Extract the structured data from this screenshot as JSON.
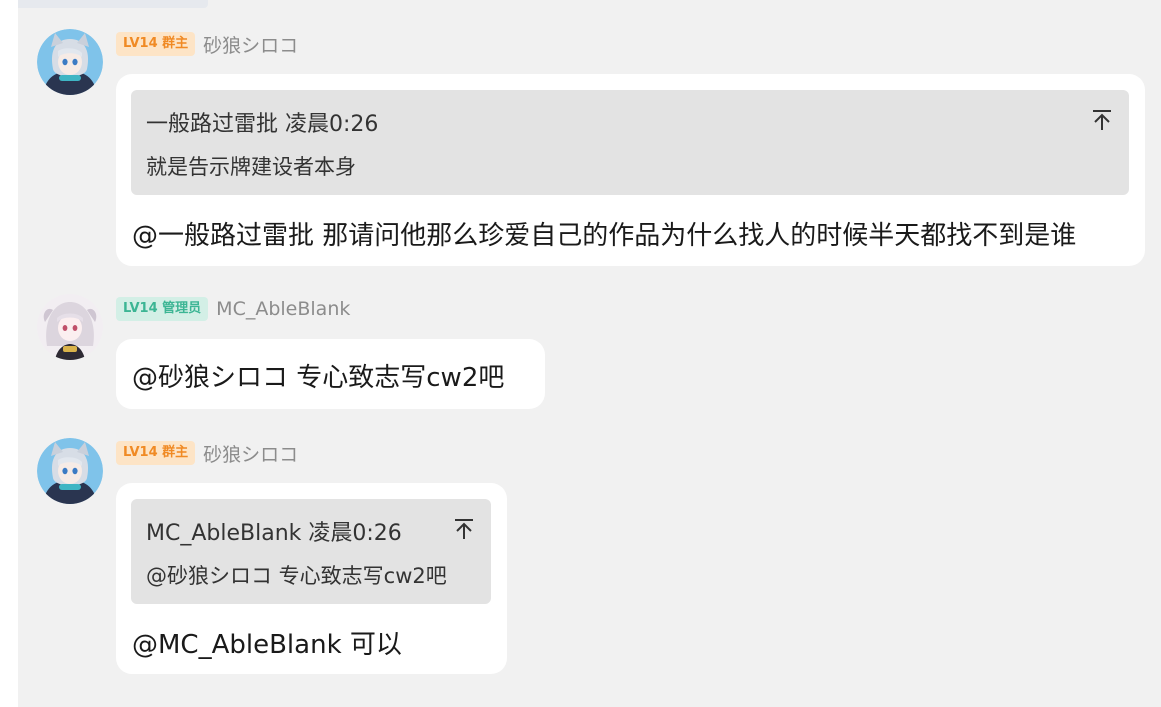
{
  "messages": [
    {
      "badge": "LV14 群主",
      "sender": "砂狼シロコ",
      "quote": {
        "author": "一般路过雷批",
        "time": "凌晨0:26",
        "text": "就是告示牌建设者本身"
      },
      "text": "@一般路过雷批 那请问他那么珍爱自己的作品为什么找人的时候半天都找不到是谁"
    },
    {
      "badge": "LV14 管理员",
      "sender": "MC_AbleBlank",
      "text": "@砂狼シロコ 专心致志写cw2吧"
    },
    {
      "badge": "LV14 群主",
      "sender": "砂狼シロコ",
      "quote": {
        "author": "MC_AbleBlank",
        "time": "凌晨0:26",
        "text": "@砂狼シロコ 专心致志写cw2吧"
      },
      "text": "@MC_AbleBlank 可以"
    }
  ],
  "icons": {
    "avatar": "anime-avatar-icon",
    "jump_to_quoted": "jump-to-top-icon"
  },
  "colors": {
    "background": "#f1f1f1",
    "bubble": "#ffffff",
    "quote_box": "#e3e3e3",
    "owner_badge_bg": "#fde4c6",
    "owner_badge_text": "#f08a24",
    "admin_badge_bg": "#d3efe6",
    "admin_badge_text": "#3cb594"
  }
}
